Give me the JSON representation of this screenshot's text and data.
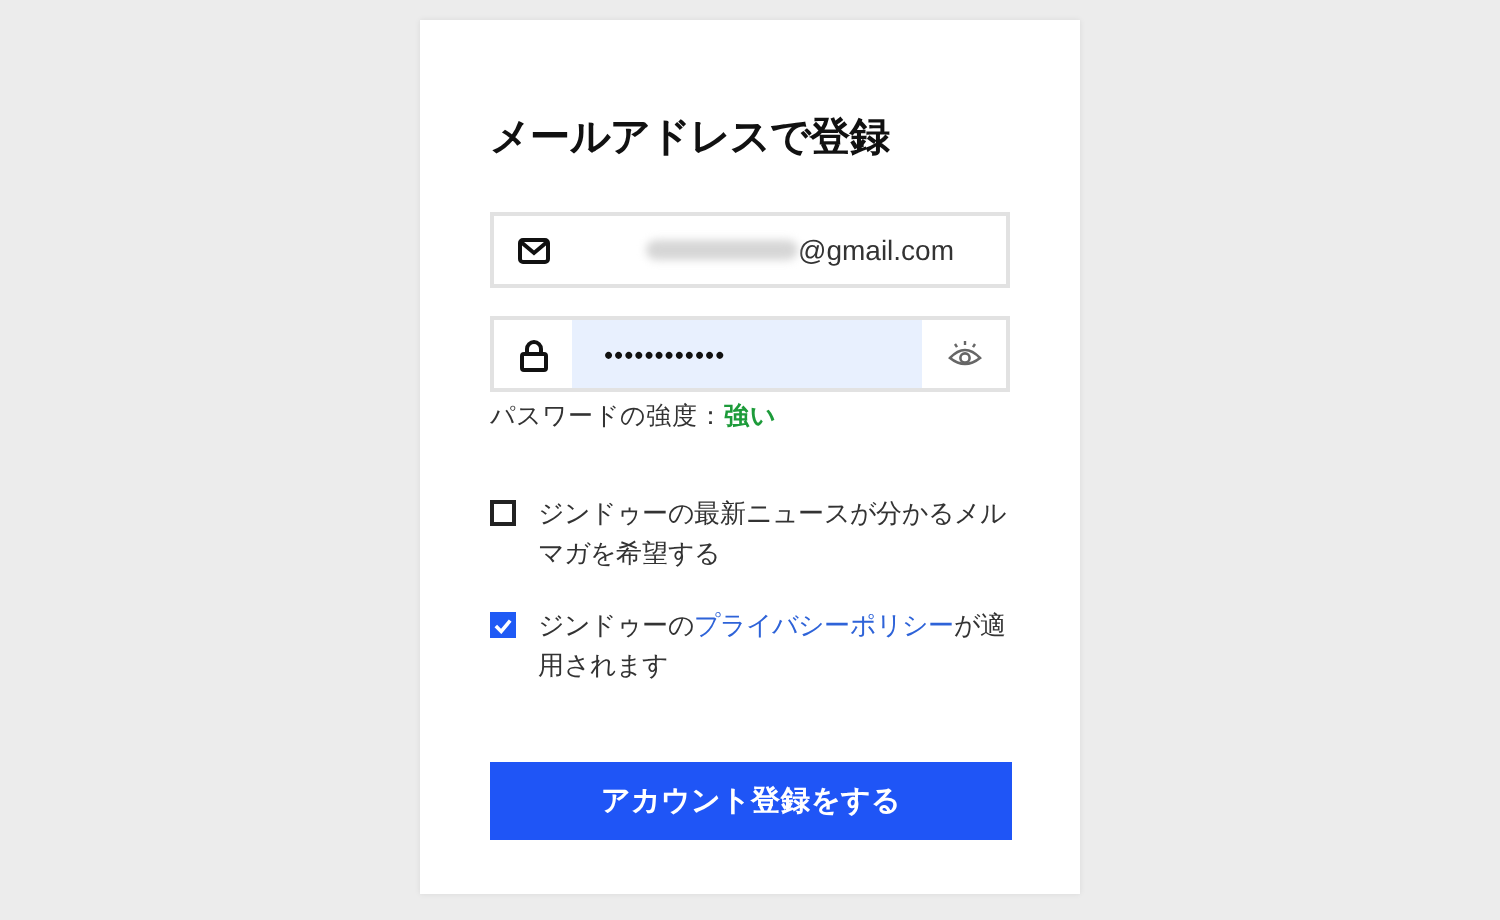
{
  "title": "メールアドレスで登録",
  "email": {
    "value": "@gmail.com",
    "redacted": true
  },
  "password": {
    "value": "••••••••••••",
    "autofilled": true
  },
  "strength": {
    "label": "パスワードの強度：",
    "value": "強い"
  },
  "checkboxes": [
    {
      "before": "ジンドゥーの最新ニュースが分かるメルマガを希望する",
      "checked": false
    },
    {
      "before": "ジンドゥーの",
      "link": "プライバシーポリシー",
      "after": "が適用されます",
      "checked": true
    }
  ],
  "submit": "アカウント登録をする"
}
